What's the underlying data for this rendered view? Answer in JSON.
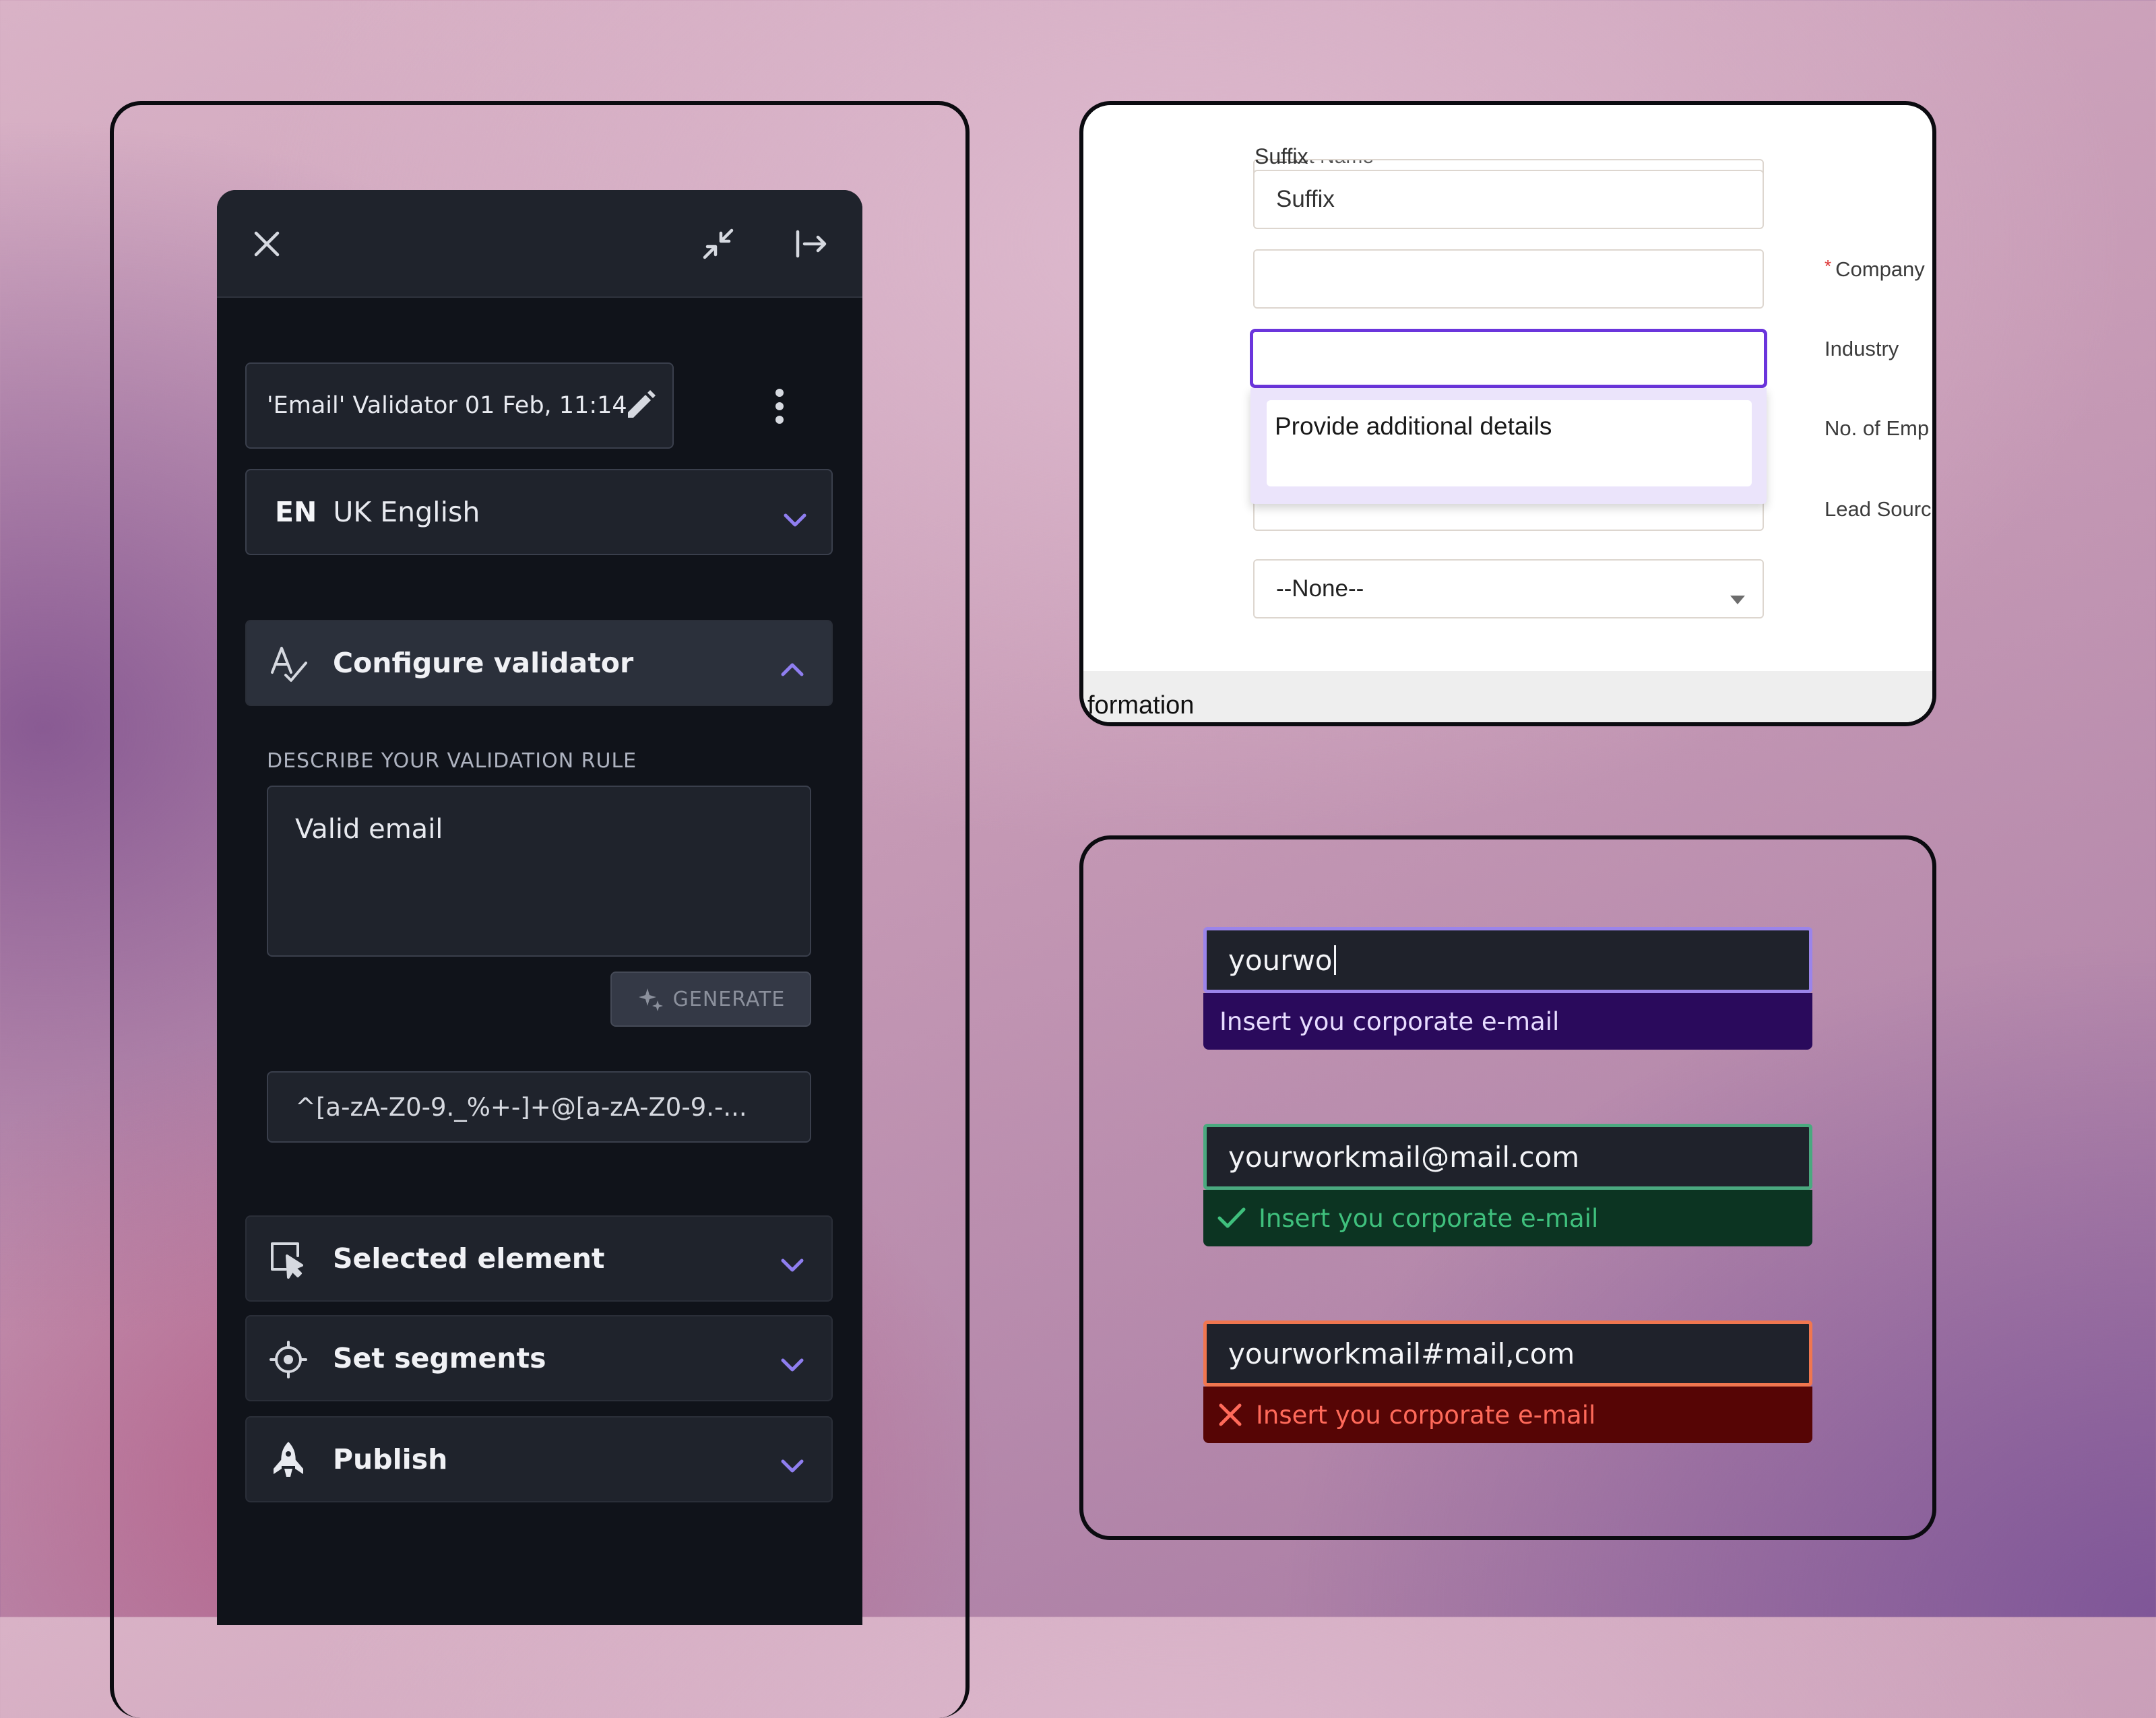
{
  "colors": {
    "accent": "#6b35dc",
    "panel_bg": "#10131a",
    "panel_header": "#1f232c",
    "chevron": "#8f7ef0",
    "valid": "#3fc07d",
    "invalid": "#ff6a5a"
  },
  "panel": {
    "header": {
      "close_icon": "close-icon",
      "collapse_icon": "collapse-icon",
      "dock_icon": "dock-right-icon"
    },
    "validator_name": "'Email' Validator 01 Feb, 11:14",
    "edit_icon": "pencil-icon",
    "more_icon": "more-vertical-icon",
    "language": {
      "code": "EN",
      "name": "UK English"
    },
    "sections": {
      "configure": {
        "label": "Configure validator",
        "icon": "spellcheck-icon",
        "expanded": true
      },
      "selected": {
        "label": "Selected element",
        "icon": "cursor-select-icon",
        "expanded": false
      },
      "segments": {
        "label": "Set segments",
        "icon": "crosshair-icon",
        "expanded": false
      },
      "publish": {
        "label": "Publish",
        "icon": "rocket-icon",
        "expanded": false
      }
    },
    "rule_label": "DESCRIBE YOUR VALIDATION RULE",
    "rule_text": "Valid email",
    "generate_label": "GENERATE",
    "regex": "^[a-zA-Z0-9._%+-]+@[a-zA-Z0-9.-..."
  },
  "form": {
    "lastname_field": "Last Name",
    "suffix_label": "Suffix",
    "suffix_placeholder": "Suffix",
    "dropdown_option": "Provide additional details",
    "select_value": "--None--",
    "labels": {
      "company": "Company",
      "company_required": "*",
      "industry": "Industry",
      "employees": "No. of Emp",
      "lead_source": "Lead Sourc"
    },
    "info_text": "formation"
  },
  "states": {
    "typing": {
      "value": "yourwo",
      "message": "Insert you corporate e-mail"
    },
    "valid": {
      "value": "yourworkmail@mail.com",
      "message": "Insert you corporate e-mail",
      "icon": "check-icon"
    },
    "invalid": {
      "value": "yourworkmail#mail,com",
      "message": "Insert you corporate e-mail",
      "icon": "cross-icon"
    }
  }
}
